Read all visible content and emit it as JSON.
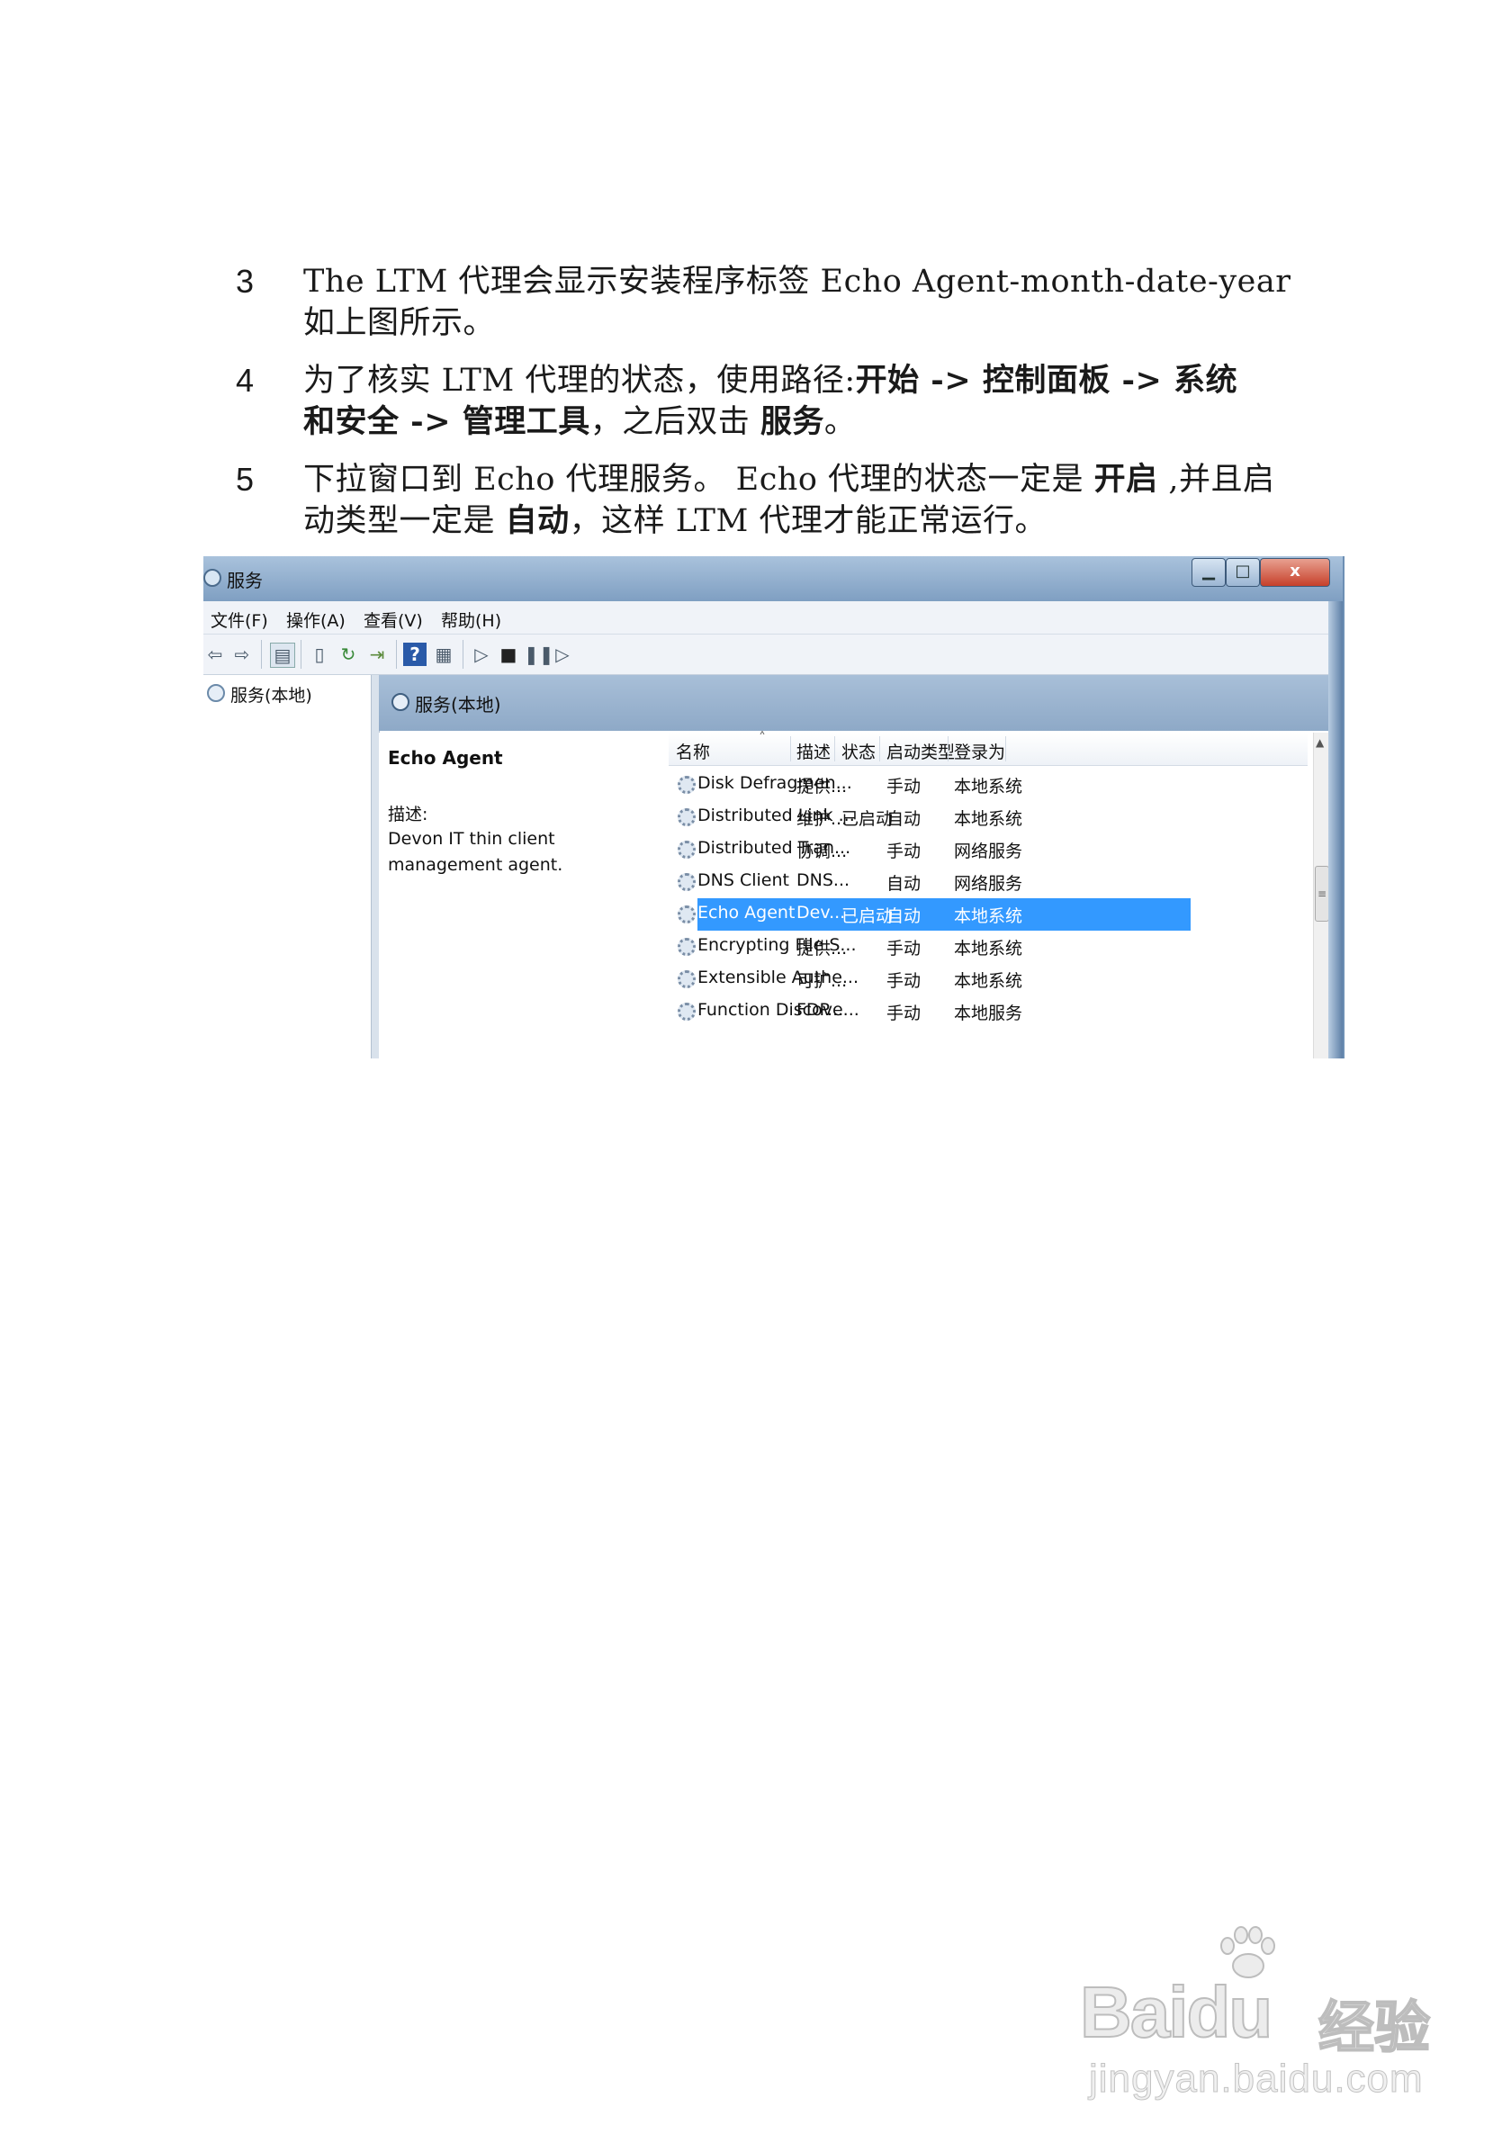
{
  "steps": [
    {
      "num": "3",
      "line1": "The LTM 代理会显示安装程序标签 Echo Agent-month-date-year",
      "line2": "如上图所示。"
    },
    {
      "num": "4",
      "l1a": "为了核实 LTM 代理的状态，使用路径:",
      "l1b": "开始 -> 控制面板 -> 系统",
      "l2a": "和安全 -> 管理工具",
      "l2b": "，之后双击 ",
      "l2c": "服务",
      "l2d": "。"
    },
    {
      "num": "5",
      "l1a": "下拉窗口到 Echo 代理服务。 Echo 代理的状态一定是 ",
      "l1b": "开启",
      "l1c": " ,并且启",
      "l2a": "动类型一定是 ",
      "l2b": "自动",
      "l2c": "，这样 LTM 代理才能正常运行。"
    }
  ],
  "window": {
    "title": "服务",
    "buttons": {
      "minimize": "▁",
      "maximize": "□",
      "close": "x"
    },
    "menu": [
      "文件(F)",
      "操作(A)",
      "查看(V)",
      "帮助(H)"
    ],
    "toolbar_icons": [
      "back-icon",
      "forward-icon",
      "show-hide-tree-icon",
      "properties-icon",
      "refresh-icon",
      "export-list-icon",
      "help-icon",
      "view-icon",
      "play-icon",
      "stop-icon",
      "pause-icon",
      "restart-icon"
    ],
    "tree_node": "服务(本地)",
    "header_title": "服务(本地)",
    "detail": {
      "name": "Echo Agent",
      "desc_label": "描述:",
      "desc_text": "Devon IT thin client management agent."
    },
    "columns": [
      "名称",
      "描述",
      "状态",
      "启动类型",
      "登录为"
    ],
    "rows": [
      {
        "name": "Disk Defragmen...",
        "desc": "提供...",
        "status": "",
        "startup": "手动",
        "logon": "本地系统"
      },
      {
        "name": "Distributed Link ...",
        "desc": "维护...",
        "status": "已启动",
        "startup": "自动",
        "logon": "本地系统"
      },
      {
        "name": "Distributed Tran...",
        "desc": "协调...",
        "status": "",
        "startup": "手动",
        "logon": "网络服务"
      },
      {
        "name": "DNS Client",
        "desc": "DNS...",
        "status": "",
        "startup": "自动",
        "logon": "网络服务"
      },
      {
        "name": "Echo Agent",
        "desc": "Dev...",
        "status": "已启动",
        "startup": "自动",
        "logon": "本地系统"
      },
      {
        "name": "Encrypting File S...",
        "desc": "提供...",
        "status": "",
        "startup": "手动",
        "logon": "本地系统"
      },
      {
        "name": "Extensible Authe...",
        "desc": "可扩...",
        "status": "",
        "startup": "手动",
        "logon": "本地系统"
      },
      {
        "name": "Function Discove...",
        "desc": "FDP...",
        "status": "",
        "startup": "手动",
        "logon": "本地服务"
      }
    ],
    "selected_row": "Echo Agent",
    "selection_color": "#3399ff"
  },
  "watermark": {
    "brand": "Bai",
    "brand2": "du",
    "brand_cn": "经验",
    "site": "jingyan.baidu.com"
  }
}
